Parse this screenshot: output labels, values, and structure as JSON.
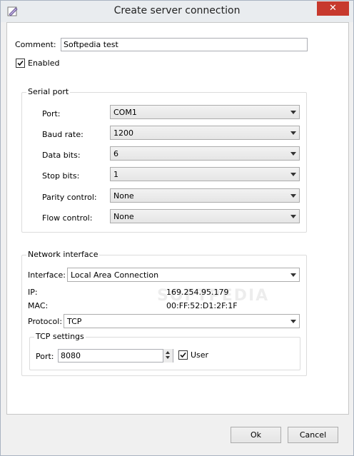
{
  "window": {
    "title": "Create server connection",
    "close_glyph": "✕"
  },
  "comment": {
    "label": "Comment:",
    "value": "Softpedia test"
  },
  "enabled": {
    "label": "Enabled",
    "checked": true
  },
  "serial_port": {
    "title": "Serial port",
    "port": {
      "label": "Port:",
      "value": "COM1"
    },
    "baud_rate": {
      "label": "Baud rate:",
      "value": "1200"
    },
    "data_bits": {
      "label": "Data bits:",
      "value": "6"
    },
    "stop_bits": {
      "label": "Stop bits:",
      "value": "1"
    },
    "parity_control": {
      "label": "Parity control:",
      "value": "None"
    },
    "flow_control": {
      "label": "Flow control:",
      "value": "None"
    }
  },
  "network": {
    "title": "Network interface",
    "interface": {
      "label": "Interface:",
      "value": "Local Area Connection"
    },
    "ip": {
      "label": "IP:",
      "value": "169.254.95.179"
    },
    "mac": {
      "label": "MAC:",
      "value": "00:FF:52:D1:2F:1F"
    },
    "protocol": {
      "label": "Protocol:",
      "value": "TCP"
    },
    "tcp_settings": {
      "title": "TCP settings",
      "port_label": "Port:",
      "port_value": "8080",
      "user_label": "User",
      "user_checked": true
    }
  },
  "buttons": {
    "ok": "Ok",
    "cancel": "Cancel"
  },
  "watermark": "SOFTPEDIA"
}
